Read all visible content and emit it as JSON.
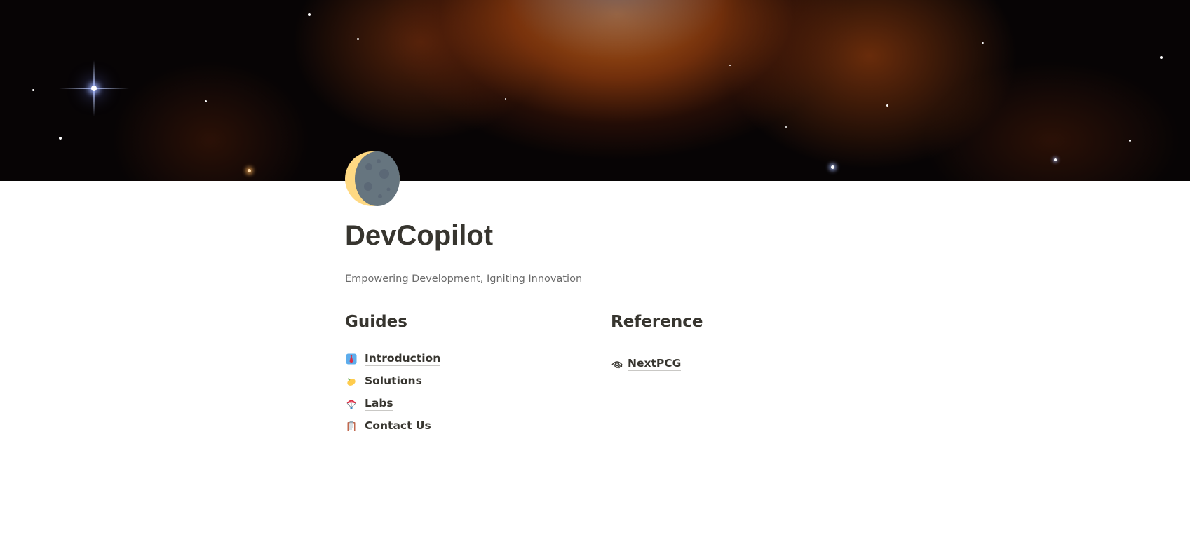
{
  "page": {
    "title": "DevCopilot",
    "subtitle": "Empowering Development, Igniting Innovation"
  },
  "icon": {
    "semantic": "waning-crescent-moon-icon",
    "colors": {
      "moon_dark": "#66757f",
      "moon_light": "#ffd983",
      "crater": "#5b6876"
    }
  },
  "columns": [
    {
      "heading": "Guides",
      "links": [
        {
          "label": "Introduction",
          "icon": "necktie-icon"
        },
        {
          "label": "Solutions",
          "icon": "lemon-icon"
        },
        {
          "label": "Labs",
          "icon": "parachute-icon"
        },
        {
          "label": "Contact Us",
          "icon": "clipboard-icon"
        }
      ]
    },
    {
      "heading": "Reference",
      "links": [
        {
          "label": "NextPCG",
          "icon": "eye-icon"
        }
      ]
    }
  ]
}
